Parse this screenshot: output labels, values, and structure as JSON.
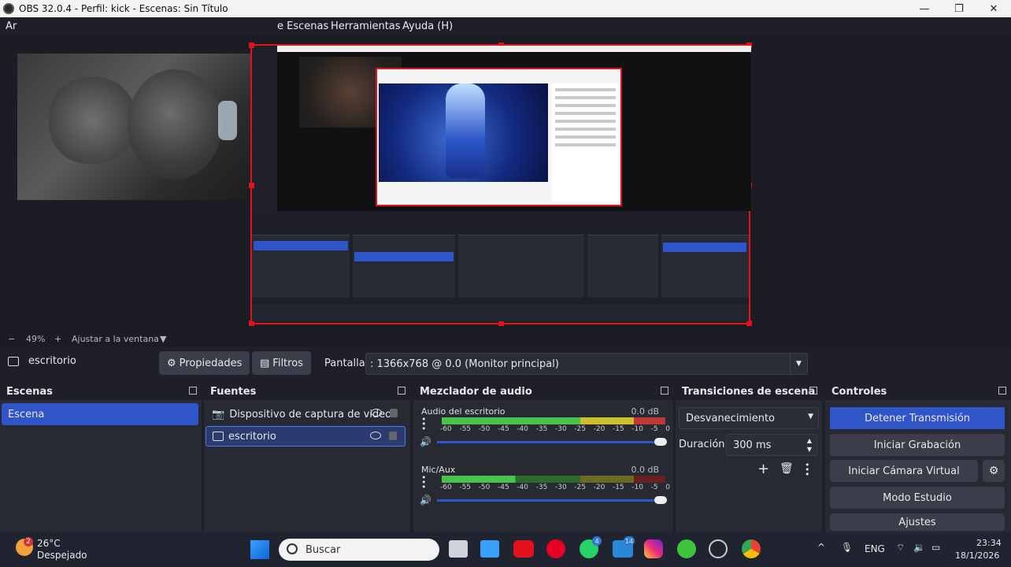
{
  "window": {
    "title": "OBS 32.0.4 - Perfil: kick - Escenas: Sin Título",
    "minimize": "—",
    "maximize": "❐",
    "close": "✕"
  },
  "menu": {
    "items": [
      "Ar",
      "e Escenas",
      "Herramientas",
      "Ayuda (H)"
    ]
  },
  "preview": {
    "zoom_minus": "−",
    "zoom": "49%",
    "zoom_plus": "+",
    "fit": "Ajustar a la ventana",
    "fit_arrow": "▼"
  },
  "source_toolbar": {
    "source_name": "escritorio",
    "properties": "Propiedades",
    "filters": "Filtros",
    "display_label": "Pantalla",
    "display_value": ": 1366x768 @ 0.0 (Monitor principal)"
  },
  "scenes": {
    "title": "Escenas",
    "items": [
      "Escena"
    ]
  },
  "sources": {
    "title": "Fuentes",
    "items": [
      {
        "label": "Dispositivo de captura de video"
      },
      {
        "label": "escritorio"
      }
    ]
  },
  "mixer": {
    "title": "Mezclador de audio",
    "channels": [
      {
        "name": "Audio del escritorio",
        "db": "0.0 dB"
      },
      {
        "name": "Mic/Aux",
        "db": "0.0 dB"
      }
    ],
    "ticks": [
      "-60",
      "-55",
      "-50",
      "-45",
      "-40",
      "-35",
      "-30",
      "-25",
      "-20",
      "-15",
      "-10",
      "-5",
      "0"
    ]
  },
  "transitions": {
    "title": "Transiciones de escena",
    "type": "Desvanecimiento",
    "duration_label": "Duración",
    "duration_value": "300 ms"
  },
  "controls": {
    "title": "Controles",
    "buttons": [
      "Detener Transmisión",
      "Iniciar Grabación",
      "Iniciar Cámara Virtual",
      "Modo Estudio",
      "Ajustes"
    ]
  },
  "taskbar": {
    "weather_temp": "26°C",
    "weather_desc": "Despejado",
    "weather_badge": "2",
    "search": "Buscar",
    "lang": "ENG",
    "time": "23:34",
    "date": "18/1/2026",
    "badge_whatsapp": "4",
    "badge_teams": "14"
  },
  "colors": {
    "accent": "#2f55c9",
    "red": "#e3101e",
    "bg": "#1e1f29",
    "dock": "#272a33"
  }
}
